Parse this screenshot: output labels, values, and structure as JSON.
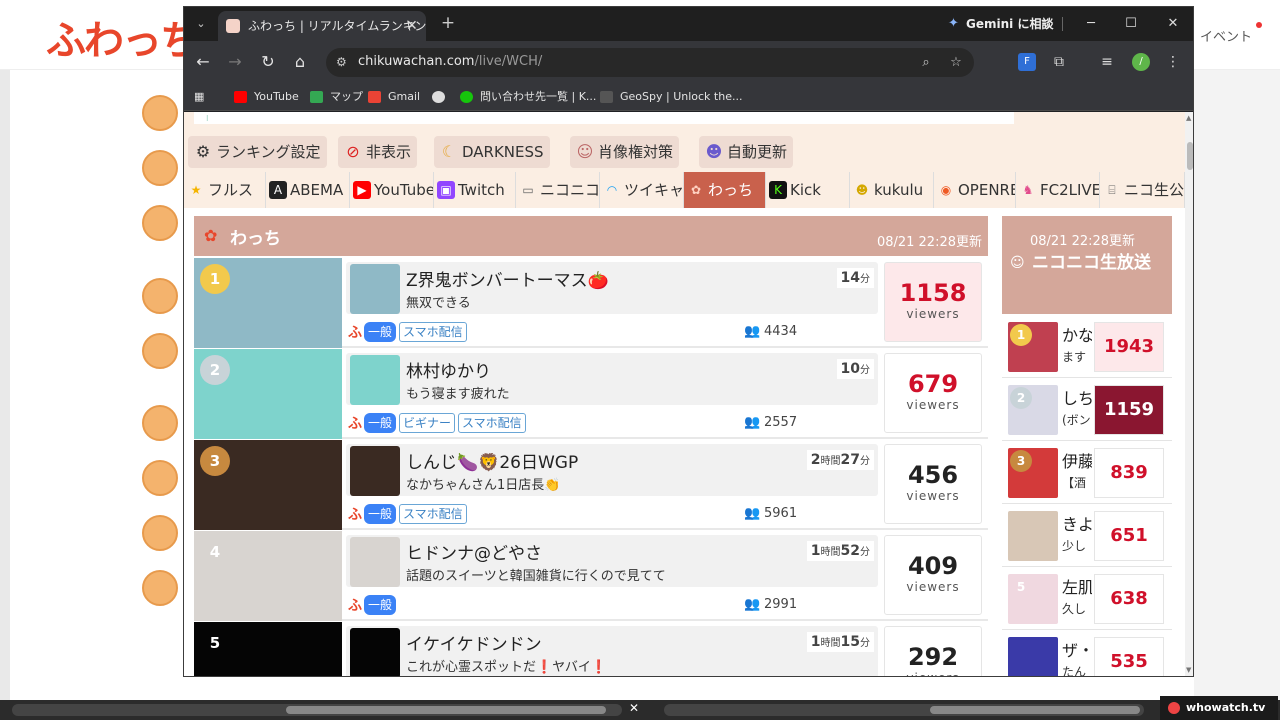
{
  "background": {
    "logo_text": "ふわっち",
    "event_link": "イベント",
    "bottom_badge": "whowatch.tv"
  },
  "browser": {
    "tab_title": "ふわっち | リアルタイムランキング",
    "gemini_label": "Gemini に相談",
    "url_host": "chikuwachan.com",
    "url_path": "/live/WCH/",
    "bookmarks": [
      {
        "label": "YouTube",
        "color": "#ff0000"
      },
      {
        "label": "マップ",
        "color": "#34a853"
      },
      {
        "label": "Gmail",
        "color": "#ea4335"
      },
      {
        "label": "",
        "color": "#dddddd"
      },
      {
        "label": "問い合わせ先一覧 | K...",
        "color": "#16c60c"
      },
      {
        "label": "GeoSpy | Unlock the...",
        "color": "#555555"
      }
    ]
  },
  "controls": [
    {
      "label": "ランキング設定",
      "icon": "gear-icon"
    },
    {
      "label": "非表示",
      "icon": "prohibited-icon"
    },
    {
      "label": "DARKNESS",
      "icon": "moon-icon"
    },
    {
      "label": "肖像権対策",
      "icon": "ghost-icon"
    },
    {
      "label": "自動更新",
      "icon": "robot-icon"
    }
  ],
  "platforms": [
    {
      "label": "フルス",
      "icon": "star-icon",
      "color": "#f5b400",
      "active": false
    },
    {
      "label": "ABEMA",
      "icon": "abema-icon",
      "color": "#222222",
      "active": false
    },
    {
      "label": "YouTube",
      "icon": "youtube-icon",
      "color": "#ff0000",
      "active": false
    },
    {
      "label": "Twitch",
      "icon": "twitch-icon",
      "color": "#9146ff",
      "active": false
    },
    {
      "label": "ニコニコ生",
      "icon": "niconico-icon",
      "color": "#888888",
      "active": false
    },
    {
      "label": "ツイキャス",
      "icon": "twitcasting-icon",
      "color": "#1da1f2",
      "active": false
    },
    {
      "label": "わっち",
      "icon": "fuwacchi-icon",
      "color": "#e8462b",
      "active": true
    },
    {
      "label": "Kick",
      "icon": "kick-icon",
      "color": "#111111",
      "active": false
    },
    {
      "label": "kukulu",
      "icon": "kukulu-icon",
      "color": "#f5c518",
      "active": false
    },
    {
      "label": "OPENREC",
      "icon": "openrec-icon",
      "color": "#ef5a24",
      "active": false
    },
    {
      "label": "FC2LIVE",
      "icon": "fc2-icon",
      "color": "#e24b8c",
      "active": false
    },
    {
      "label": "ニコ生公式",
      "icon": "tv-icon",
      "color": "#888888",
      "active": false
    }
  ],
  "main_panel": {
    "title": "わっち",
    "updated": "08/21 22:28更新",
    "viewers_label": "viewers",
    "streams": [
      {
        "rank": "1",
        "name": "Z界鬼ボンバートーマス🍅",
        "desc": "無双できる",
        "dur_main": "14",
        "dur_unit": "分",
        "dur_hour": "",
        "dur_hour_unit": "",
        "genre": "一般",
        "tags": [
          "スマホ配信"
        ],
        "total": "4434",
        "viewers": "1158",
        "highlight": true,
        "thumb_color": "#8fb9c6",
        "rank_color": "#f2c94c"
      },
      {
        "rank": "2",
        "name": "林村ゆかり",
        "desc": "もう寝ます疲れた",
        "dur_main": "10",
        "dur_unit": "分",
        "dur_hour": "",
        "dur_hour_unit": "",
        "genre": "一般",
        "tags": [
          "ビギナー",
          "スマホ配信"
        ],
        "total": "2557",
        "viewers": "679",
        "highlight": false,
        "thumb_color": "#7ed3cc",
        "rank_color": "#c8d3d8"
      },
      {
        "rank": "3",
        "name": "しんじ🍆🦁26日WGP",
        "desc": "なかちゃんさん1日店長👏",
        "dur_main": "27",
        "dur_unit": "分",
        "dur_hour": "2",
        "dur_hour_unit": "時間",
        "genre": "一般",
        "tags": [
          "スマホ配信"
        ],
        "total": "5961",
        "viewers": "456",
        "highlight": false,
        "thumb_color": "#3a2a22",
        "rank_color": "#c7893f"
      },
      {
        "rank": "4",
        "name": "ヒドンナ@どやさ",
        "desc": "話題のスイーツと韓国雑貨に行くので見てて",
        "dur_main": "52",
        "dur_unit": "分",
        "dur_hour": "1",
        "dur_hour_unit": "時間",
        "genre": "一般",
        "tags": [],
        "total": "2991",
        "viewers": "409",
        "highlight": false,
        "thumb_color": "#d8d4d0",
        "rank_color": "rgba(0,0,0,0)"
      },
      {
        "rank": "5",
        "name": "イケイケドンドン",
        "desc": "これが心霊スポットだ❗ヤバイ❗",
        "dur_main": "15",
        "dur_unit": "分",
        "dur_hour": "1",
        "dur_hour_unit": "時間",
        "genre": "",
        "tags": [],
        "total": "",
        "viewers": "292",
        "highlight": false,
        "thumb_color": "#050505",
        "rank_color": "rgba(0,0,0,0)"
      }
    ]
  },
  "side_panel": {
    "updated": "08/21 22:28更新",
    "title": "ニコニコ生放送",
    "items": [
      {
        "rank": "1",
        "name": "かな",
        "sub": "ます",
        "viewers": "1943",
        "style": "hl",
        "thumb_color": "#c04050",
        "rank_color": "#f2c94c"
      },
      {
        "rank": "2",
        "name": "しち",
        "sub": "(ボン",
        "viewers": "1159",
        "style": "img",
        "thumb_color": "#d9d9e6",
        "rank_color": "#c8d3d8"
      },
      {
        "rank": "3",
        "name": "伊藤",
        "sub": "【酒",
        "viewers": "839",
        "style": "",
        "thumb_color": "#d33a3a",
        "rank_color": "#c7893f"
      },
      {
        "rank": "",
        "name": "きよ",
        "sub": "少し",
        "viewers": "651",
        "style": "",
        "thumb_color": "#d8c7b6",
        "rank_color": "rgba(0,0,0,0)"
      },
      {
        "rank": "5",
        "name": "左肌",
        "sub": "久し",
        "viewers": "638",
        "style": "",
        "thumb_color": "#f0d8e0",
        "rank_color": "rgba(0,0,0,0)"
      },
      {
        "rank": "",
        "name": "ザ・",
        "sub": "たん",
        "viewers": "535",
        "style": "",
        "thumb_color": "#3a3aa8",
        "rank_color": "rgba(0,0,0,0)"
      }
    ]
  }
}
